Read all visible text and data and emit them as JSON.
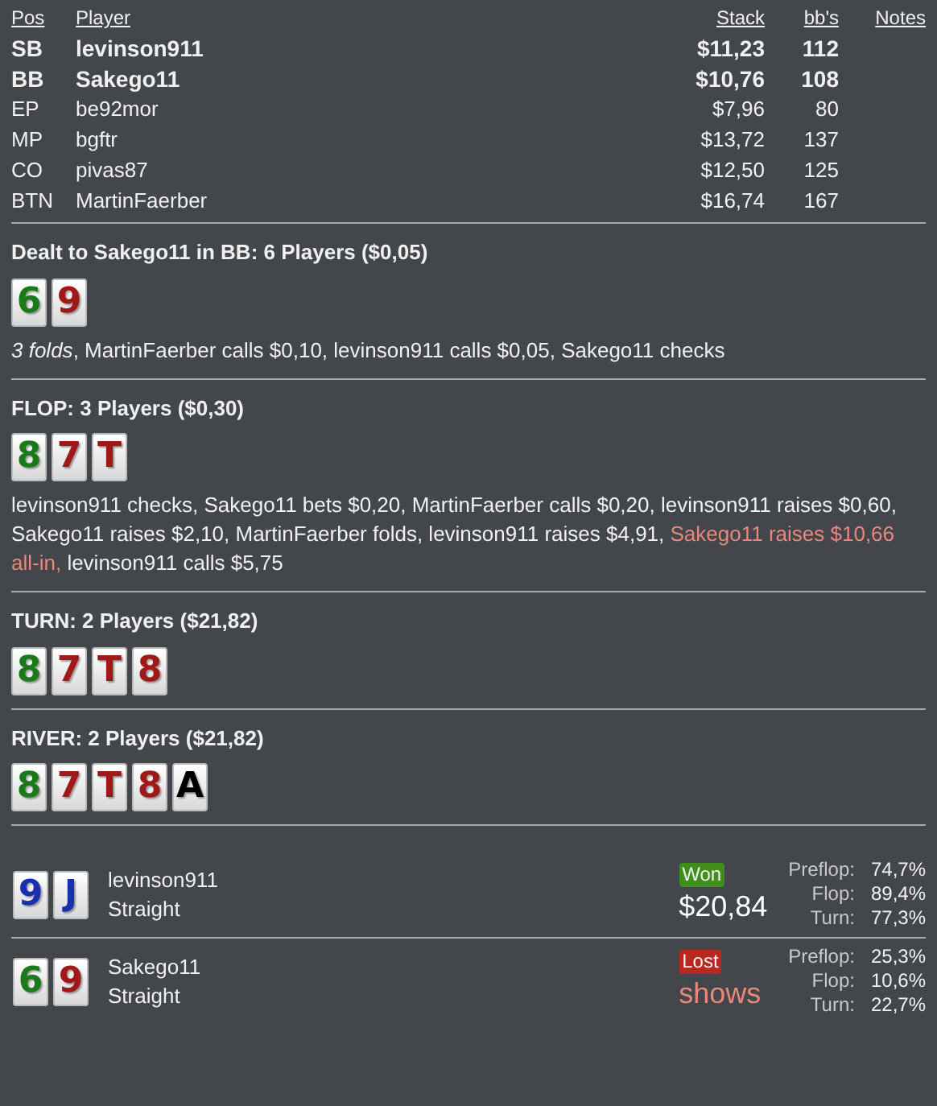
{
  "players_table": {
    "columns": [
      "Pos",
      "Player",
      "Stack",
      "bb's",
      "Notes"
    ],
    "rows": [
      {
        "pos": "SB",
        "player": "levinson911",
        "stack": "$11,23",
        "bbs": "112",
        "bold": true
      },
      {
        "pos": "BB",
        "player": "Sakego11",
        "stack": "$10,76",
        "bbs": "108",
        "bold": true
      },
      {
        "pos": "EP",
        "player": "be92mor",
        "stack": "$7,96",
        "bbs": "80",
        "bold": false
      },
      {
        "pos": "MP",
        "player": "bgftr",
        "stack": "$13,72",
        "bbs": "137",
        "bold": false
      },
      {
        "pos": "CO",
        "player": "pivas87",
        "stack": "$12,50",
        "bbs": "125",
        "bold": false
      },
      {
        "pos": "BTN",
        "player": "MartinFaerber",
        "stack": "$16,74",
        "bbs": "167",
        "bold": false
      }
    ]
  },
  "streets": [
    {
      "title": "Dealt to Sakego11 in BB: 6 Players ($0,05)",
      "cards": [
        {
          "rank": "6",
          "color": "#1a7a1a"
        },
        {
          "rank": "9",
          "color": "#a01818"
        }
      ],
      "actions": [
        {
          "kind": "italic",
          "text": "3 folds"
        },
        {
          "kind": "plain",
          "text": ", MartinFaerber calls $0,10, levinson911 calls $0,05, Sakego11 checks"
        }
      ]
    },
    {
      "title": "FLOP: 3 Players ($0,30)",
      "cards": [
        {
          "rank": "8",
          "color": "#1a7a1a"
        },
        {
          "rank": "7",
          "color": "#a01818"
        },
        {
          "rank": "T",
          "color": "#a01818"
        }
      ],
      "actions": [
        {
          "kind": "plain",
          "text": "levinson911 checks, Sakego11 bets $0,20, MartinFaerber calls $0,20, levinson911 raises $0,60, Sakego11 raises $2,10, MartinFaerber folds, levinson911 raises $4,91, "
        },
        {
          "kind": "allin",
          "text": "Sakego11 raises $10,66 all-in,"
        },
        {
          "kind": "plain",
          "text": " levinson911 calls $5,75"
        }
      ]
    },
    {
      "title": "TURN: 2 Players ($21,82)",
      "cards": [
        {
          "rank": "8",
          "color": "#1a7a1a"
        },
        {
          "rank": "7",
          "color": "#a01818"
        },
        {
          "rank": "T",
          "color": "#a01818"
        },
        {
          "rank": "8",
          "color": "#a01818"
        }
      ]
    },
    {
      "title": "RIVER: 2 Players ($21,82)",
      "cards": [
        {
          "rank": "8",
          "color": "#1a7a1a"
        },
        {
          "rank": "7",
          "color": "#a01818"
        },
        {
          "rank": "T",
          "color": "#a01818"
        },
        {
          "rank": "8",
          "color": "#a01818"
        },
        {
          "rank": "A",
          "color": "#000000"
        }
      ]
    }
  ],
  "results": [
    {
      "player": "levinson911",
      "hand": "Straight",
      "cards": [
        {
          "rank": "9",
          "color": "#1830b0"
        },
        {
          "rank": "J",
          "color": "#1830b0"
        }
      ],
      "kind": "won",
      "badge": "Won",
      "amount": "$20,84",
      "equity": [
        {
          "label": "Preflop:",
          "value": "74,7%"
        },
        {
          "label": "Flop:",
          "value": "89,4%"
        },
        {
          "label": "Turn:",
          "value": "77,3%"
        }
      ]
    },
    {
      "player": "Sakego11",
      "hand": "Straight",
      "cards": [
        {
          "rank": "6",
          "color": "#1a7a1a"
        },
        {
          "rank": "9",
          "color": "#a01818"
        }
      ],
      "kind": "lost",
      "badge": "Lost",
      "amount": "shows",
      "equity": [
        {
          "label": "Preflop:",
          "value": "25,3%"
        },
        {
          "label": "Flop:",
          "value": "10,6%"
        },
        {
          "label": "Turn:",
          "value": "22,7%"
        }
      ]
    }
  ]
}
